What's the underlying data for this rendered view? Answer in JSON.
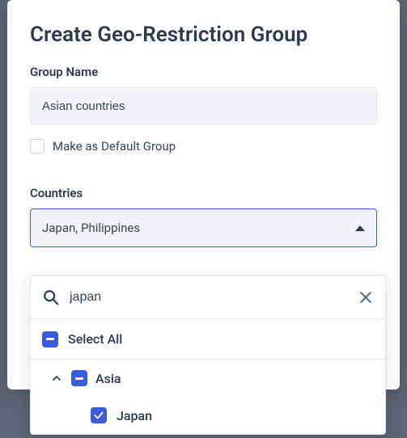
{
  "modal": {
    "title": "Create Geo-Restriction Group",
    "groupName": {
      "label": "Group Name",
      "value": "Asian countries"
    },
    "defaultGroup": {
      "label": "Make as Default Group",
      "checked": false
    },
    "countries": {
      "label": "Countries",
      "selectedText": "Japan, Philippines"
    }
  },
  "dropdown": {
    "searchValue": "japan",
    "selectAllLabel": "Select All",
    "region": {
      "name": "Asia",
      "expanded": true,
      "state": "indeterminate"
    },
    "items": [
      {
        "name": "Japan",
        "checked": true
      }
    ]
  }
}
